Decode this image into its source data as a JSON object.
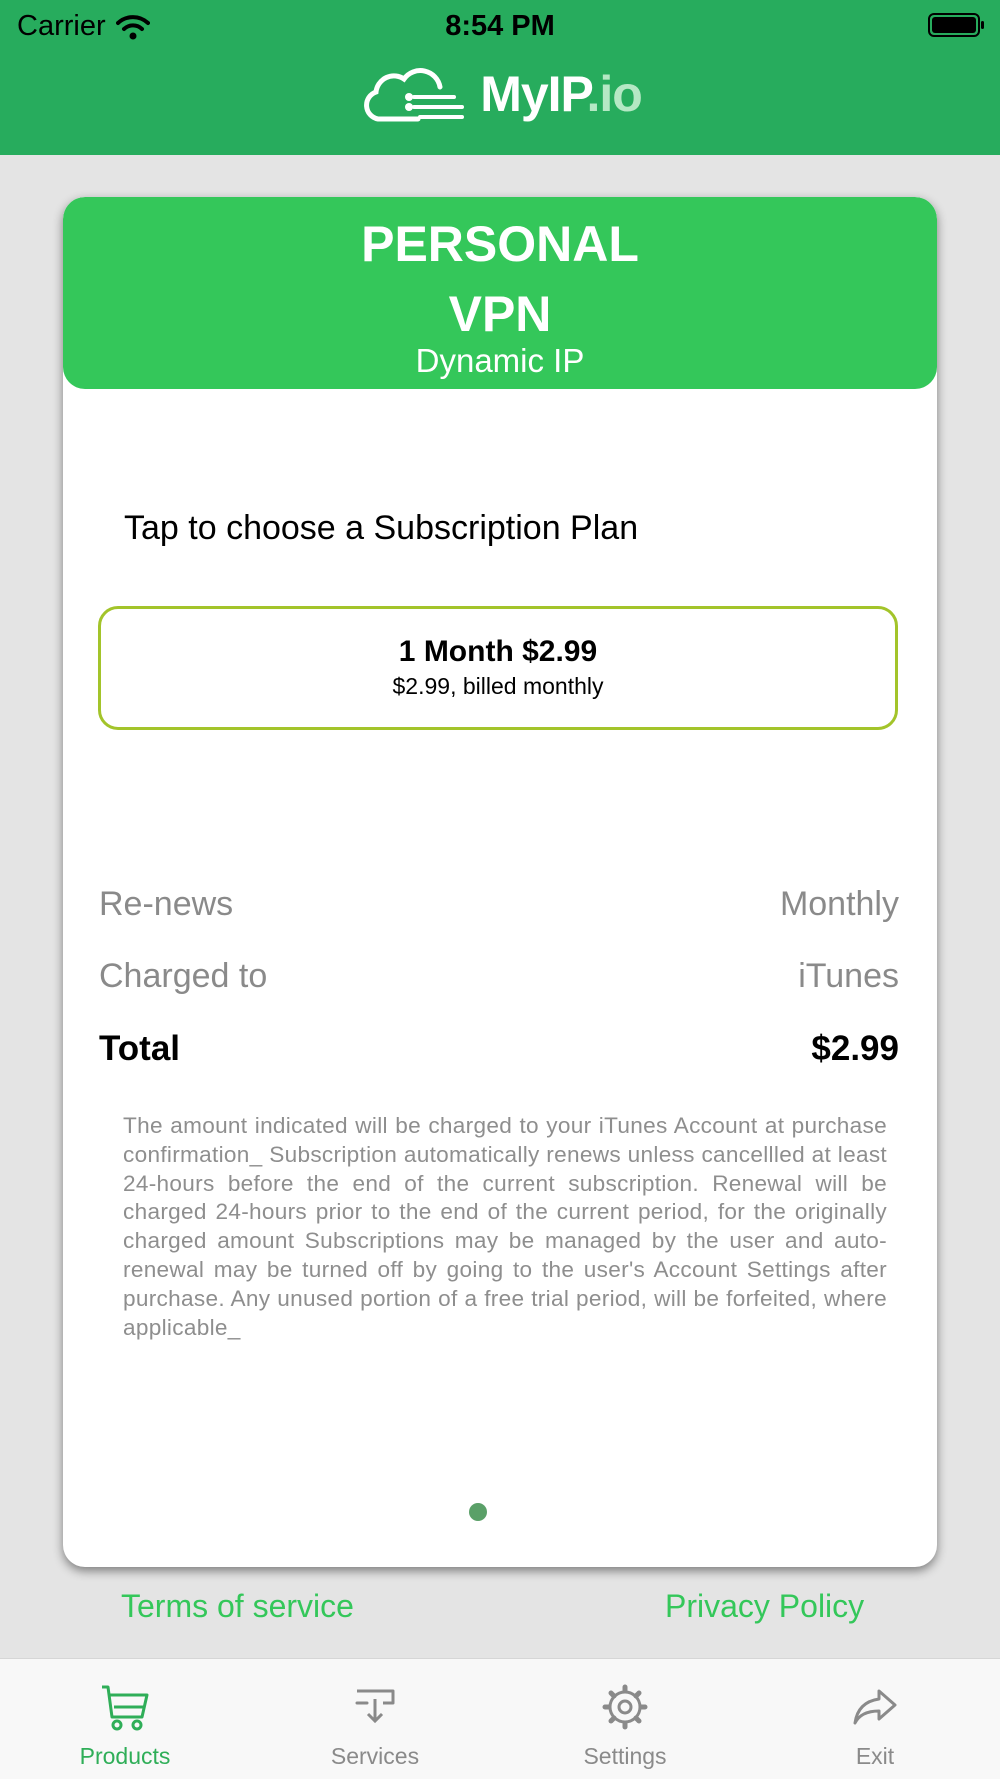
{
  "status_bar": {
    "carrier": "Carrier",
    "time": "8:54 PM"
  },
  "header": {
    "logo_main": "MyIP",
    "logo_suffix": ".io"
  },
  "plan": {
    "title": "PERSONAL\nVPN",
    "subtitle": "Dynamic IP",
    "prompt": "Tap to choose a Subscription Plan",
    "option": {
      "title": "1 Month $2.99",
      "detail": "$2.99, billed monthly"
    }
  },
  "summary": {
    "renews_label": "Re-news",
    "renews_value": "Monthly",
    "charged_label": "Charged to",
    "charged_value": "iTunes",
    "total_label": "Total",
    "total_value": "$2.99"
  },
  "legal_text": "The amount indicated will be charged to your iTunes Account at purchase confirmation_ Subscription automatically renews unless cancellled at least 24-hours before the end of the current subscription. Renewal will be charged 24-hours prior to the end of the current period, for the originally charged amount Subscriptions may be managed by the user and auto-renewal may be turned off by going to the user's Account Settings after purchase. Any unused portion of a free trial period, will be forfeited, where applicable_",
  "links": {
    "terms": "Terms of service",
    "privacy": "Privacy Policy"
  },
  "tabs": [
    {
      "label": "Products",
      "icon": "cart-icon",
      "active": true
    },
    {
      "label": "Services",
      "icon": "download-tray-icon",
      "active": false
    },
    {
      "label": "Settings",
      "icon": "gear-icon",
      "active": false
    },
    {
      "label": "Exit",
      "icon": "share-arrow-icon",
      "active": false
    }
  ],
  "colors": {
    "header_green": "#27ac5d",
    "plan_green": "#34c75a",
    "option_border": "#a3c42a",
    "tab_active": "#2fae58"
  }
}
